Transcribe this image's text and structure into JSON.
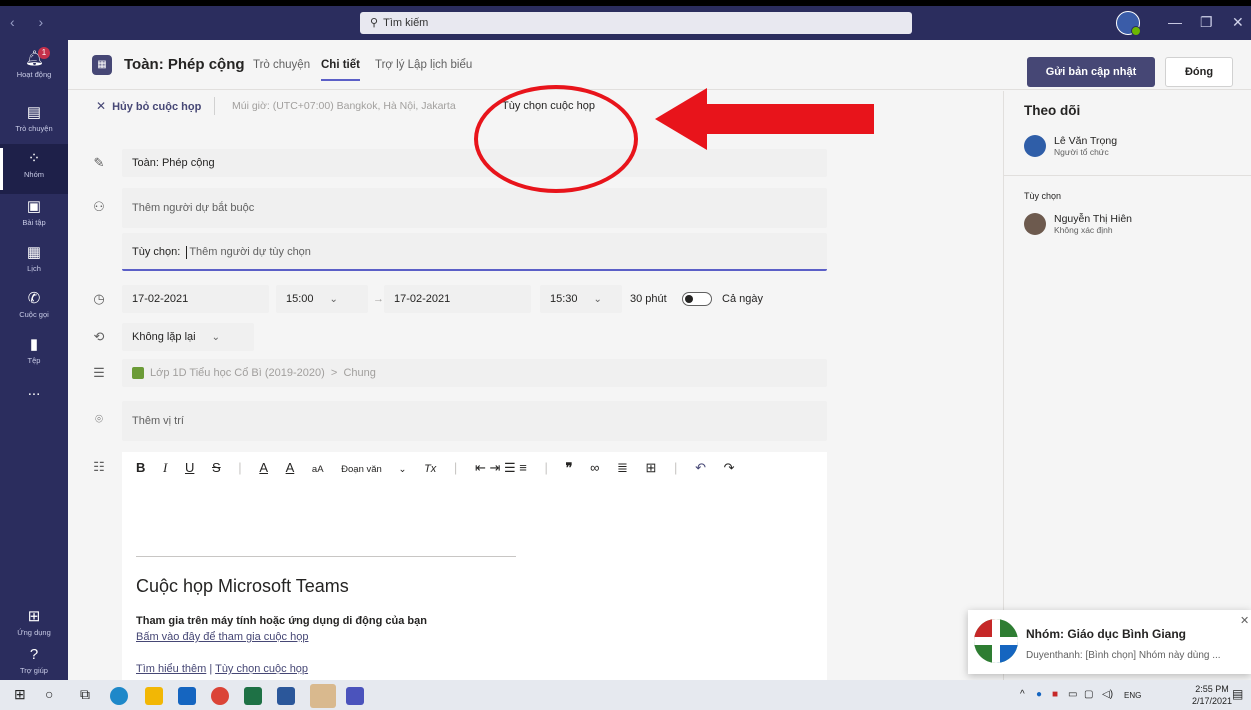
{
  "titlebar": {
    "search_placeholder": "Tìm kiếm",
    "nav_arrows": "‹ ›"
  },
  "rail": {
    "items": [
      {
        "label": "Hoạt động",
        "icon": "bell-icon",
        "badge": "1"
      },
      {
        "label": "Trò chuyện",
        "icon": "chat-icon"
      },
      {
        "label": "Nhóm",
        "icon": "teams-icon"
      },
      {
        "label": "Bài tập",
        "icon": "assignments-icon"
      },
      {
        "label": "Lịch",
        "icon": "calendar-icon"
      },
      {
        "label": "Cuộc gọi",
        "icon": "phone-icon"
      },
      {
        "label": "Tệp",
        "icon": "file-icon"
      },
      {
        "label": "...",
        "icon": "more-icon"
      }
    ],
    "bottom": [
      {
        "label": "Ứng dụng",
        "icon": "apps-icon"
      },
      {
        "label": "Trợ giúp",
        "icon": "help-icon"
      }
    ]
  },
  "header": {
    "title": "Toàn: Phép cộng",
    "tabs": [
      "Trò chuyện",
      "Chi tiết",
      "Trợ lý Lập lịch biểu"
    ],
    "active_tab": "Chi tiết",
    "update_button": "Gửi bản cập nhật",
    "close_button": "Đóng"
  },
  "subbar": {
    "cancel": "Hủy bỏ cuộc họp",
    "timezone": "Múi giờ: (UTC+07:00) Bangkok, Hà Nội, Jakarta",
    "meeting_options": "Tùy chọn cuộc họp"
  },
  "form": {
    "title_value": "Toàn: Phép cộng",
    "required_placeholder": "Thêm người dự bắt buộc",
    "optional_label": "Tùy chọn:",
    "optional_placeholder": "Thêm người dự tùy chọn",
    "start_date": "17-02-2021",
    "start_time": "15:00",
    "end_date": "17-02-2021",
    "end_time": "15:30",
    "duration": "30 phút",
    "all_day": "Cả ngày",
    "all_day_on": false,
    "repeat": "Không lặp lại",
    "channel_team": "Lớp 1D Tiểu học Cổ Bì (2019-2020)",
    "channel_sep": ">",
    "channel_name": "Chung",
    "location_placeholder": "Thêm vị trí"
  },
  "editor": {
    "toolbar": [
      "B",
      "I",
      "U",
      "S",
      "|",
      "A",
      "A",
      "aA",
      "Đoạn văn",
      "Tx",
      "|",
      "lists",
      "|",
      "quote",
      "link",
      "align",
      "table",
      "|",
      "undo",
      "redo"
    ],
    "paragraph_label": "Đoạn văn",
    "heading": "Cuộc họp Microsoft Teams",
    "join_text": "Tham gia trên máy tính hoặc ứng dụng di động của bạn",
    "join_link": "Bấm vào đây để tham gia cuộc họp",
    "learn_more": "Tìm hiểu thêm",
    "link_sep": "|",
    "options_link": "Tùy chọn cuộc họp"
  },
  "tracking": {
    "title": "Theo dõi",
    "organizer": {
      "name": "Lê Văn Trọng",
      "role": "Người tổ chức"
    },
    "optional_label": "Tùy chọn",
    "optional_attendee": {
      "name": "Nguyễn Thị Hiên",
      "role": "Không xác định"
    }
  },
  "toast": {
    "title": "Nhóm: Giáo dục Bình Giang",
    "body": "Duyenthanh: [Bình chọn] Nhóm này dùng ..."
  },
  "taskbar": {
    "lang": "ENG",
    "time": "2:55 PM",
    "date": "2/17/2021"
  },
  "colors": {
    "rail": "#2b2d5e",
    "accent": "#464775",
    "highlight": "#e8141b"
  }
}
